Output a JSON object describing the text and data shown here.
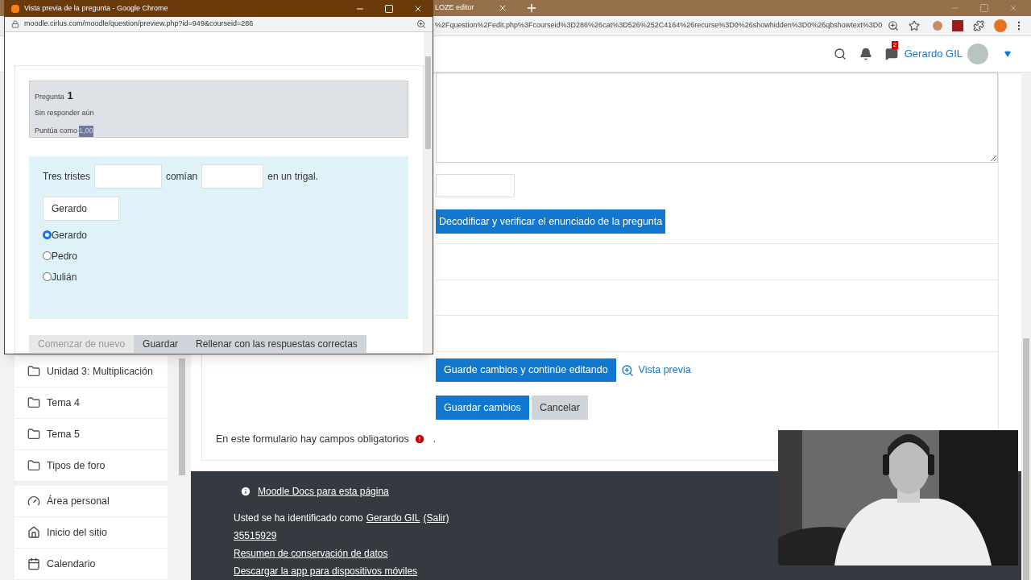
{
  "browser": {
    "tab_title": "LOZE editor",
    "url": "%2Fquestion%2Fedit.php%3Fcourseid%3D286%26cat%3D526%252C4164%26recurse%3D0%26showhidden%3D0%26qbshowtext%3D0",
    "notification_count": "2",
    "user_name": "Gerardo GIL"
  },
  "popup": {
    "title": "Vista previa de la pregunta - Google Chrome",
    "url": "moodle.cirlus.com/moodle/question/preview.php?id=949&courseid=286",
    "question": {
      "label": "Pregunta",
      "number": "1",
      "status": "Sin responder aún",
      "grade_label": "Puntúa como",
      "grade_value": "1,00"
    },
    "cloze": {
      "before": "Tres tristes",
      "middle": "comían",
      "after": "en un trigal.",
      "dropdown_value": "Gerardo",
      "options": [
        {
          "label": "Gerardo",
          "selected": true
        },
        {
          "label": "Pedro",
          "selected": false
        },
        {
          "label": "Julián",
          "selected": false
        }
      ]
    },
    "buttons": [
      {
        "label": "Comenzar de nuevo",
        "disabled": true
      },
      {
        "label": "Guardar",
        "disabled": false
      },
      {
        "label": "Rellenar con las respuestas correctas",
        "disabled": false
      }
    ]
  },
  "sidebar": {
    "groups": [
      [
        {
          "label": "Unidad 3: Multiplicación",
          "kind": "folder"
        },
        {
          "label": "Tema 4",
          "kind": "folder"
        },
        {
          "label": "Tema 5",
          "kind": "folder"
        },
        {
          "label": "Tipos de foro",
          "kind": "folder"
        }
      ],
      [
        {
          "label": "Área personal",
          "kind": "dashboard"
        },
        {
          "label": "Inicio del sitio",
          "kind": "home"
        },
        {
          "label": "Calendario",
          "kind": "calendar"
        }
      ]
    ]
  },
  "form": {
    "decode_button": "Decodificar y verificar el enunciado de la pregunta",
    "save_continue_button": "Guarde cambios y continúe editando",
    "preview_link": "Vista previa",
    "save_button": "Guardar cambios",
    "cancel_button": "Cancelar",
    "required_note": "En este formulario hay campos obligatorios",
    "required_end": "."
  },
  "footer": {
    "docs_link": "Moodle Docs para esta página",
    "login_text": "Usted se ha identificado como",
    "user_link": "Gerardo GIL",
    "logout_link": "(Salir)",
    "links": [
      "35515929",
      "Resumen de conservación de datos",
      "Descargar la app para dispositivos móviles"
    ]
  }
}
